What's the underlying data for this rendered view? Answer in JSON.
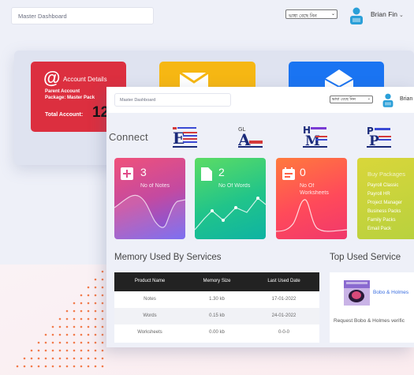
{
  "back": {
    "header": {
      "search_placeholder": "Master Dashboard",
      "language": "ভাষা বেছে নিন",
      "user_name": "Brian Fin"
    },
    "account_card": {
      "title": "Account Details",
      "line1": "Parent Account",
      "line2": "Package: Master Pack",
      "total_label": "Total Account:",
      "total_value": "12"
    }
  },
  "front": {
    "header": {
      "search_placeholder": "Master Dashboard",
      "language": "ভাষা বেছে নিন",
      "user_name": "Brian"
    },
    "connect_title": "Connect",
    "stats": [
      {
        "value": "3",
        "label": "No of Notes"
      },
      {
        "value": "2",
        "label": "No Of Words"
      },
      {
        "value": "0",
        "label_line1": "No Of",
        "label_line2": "Worksheets"
      }
    ],
    "packages": {
      "title": "Buy Packages",
      "items": [
        "Payroll Classic",
        "Payroll HR",
        "Project Manager",
        "Business Packs",
        "Family Packs",
        "Email Pack"
      ]
    },
    "memory": {
      "title": "Memory Used By Services",
      "columns": [
        "Product Name",
        "Memory Size",
        "Last Used Date"
      ],
      "rows": [
        [
          "Notes",
          "1.30 kb",
          "17-01-2022"
        ],
        [
          "Words",
          "0.15 kb",
          "24-01-2022"
        ],
        [
          "Worksheets",
          "0.00 kb",
          "0-0-0"
        ]
      ]
    },
    "top_used": {
      "title": "Top Used Service",
      "service_name": "Bobo & Holmes",
      "request_text": "Request Bobo & Holmes verific"
    }
  },
  "colors": {
    "account_red": "#dc2f3f",
    "yellow_card": "#f6b713",
    "blue_card": "#1a74f2",
    "link_blue": "#3a6ee0"
  }
}
